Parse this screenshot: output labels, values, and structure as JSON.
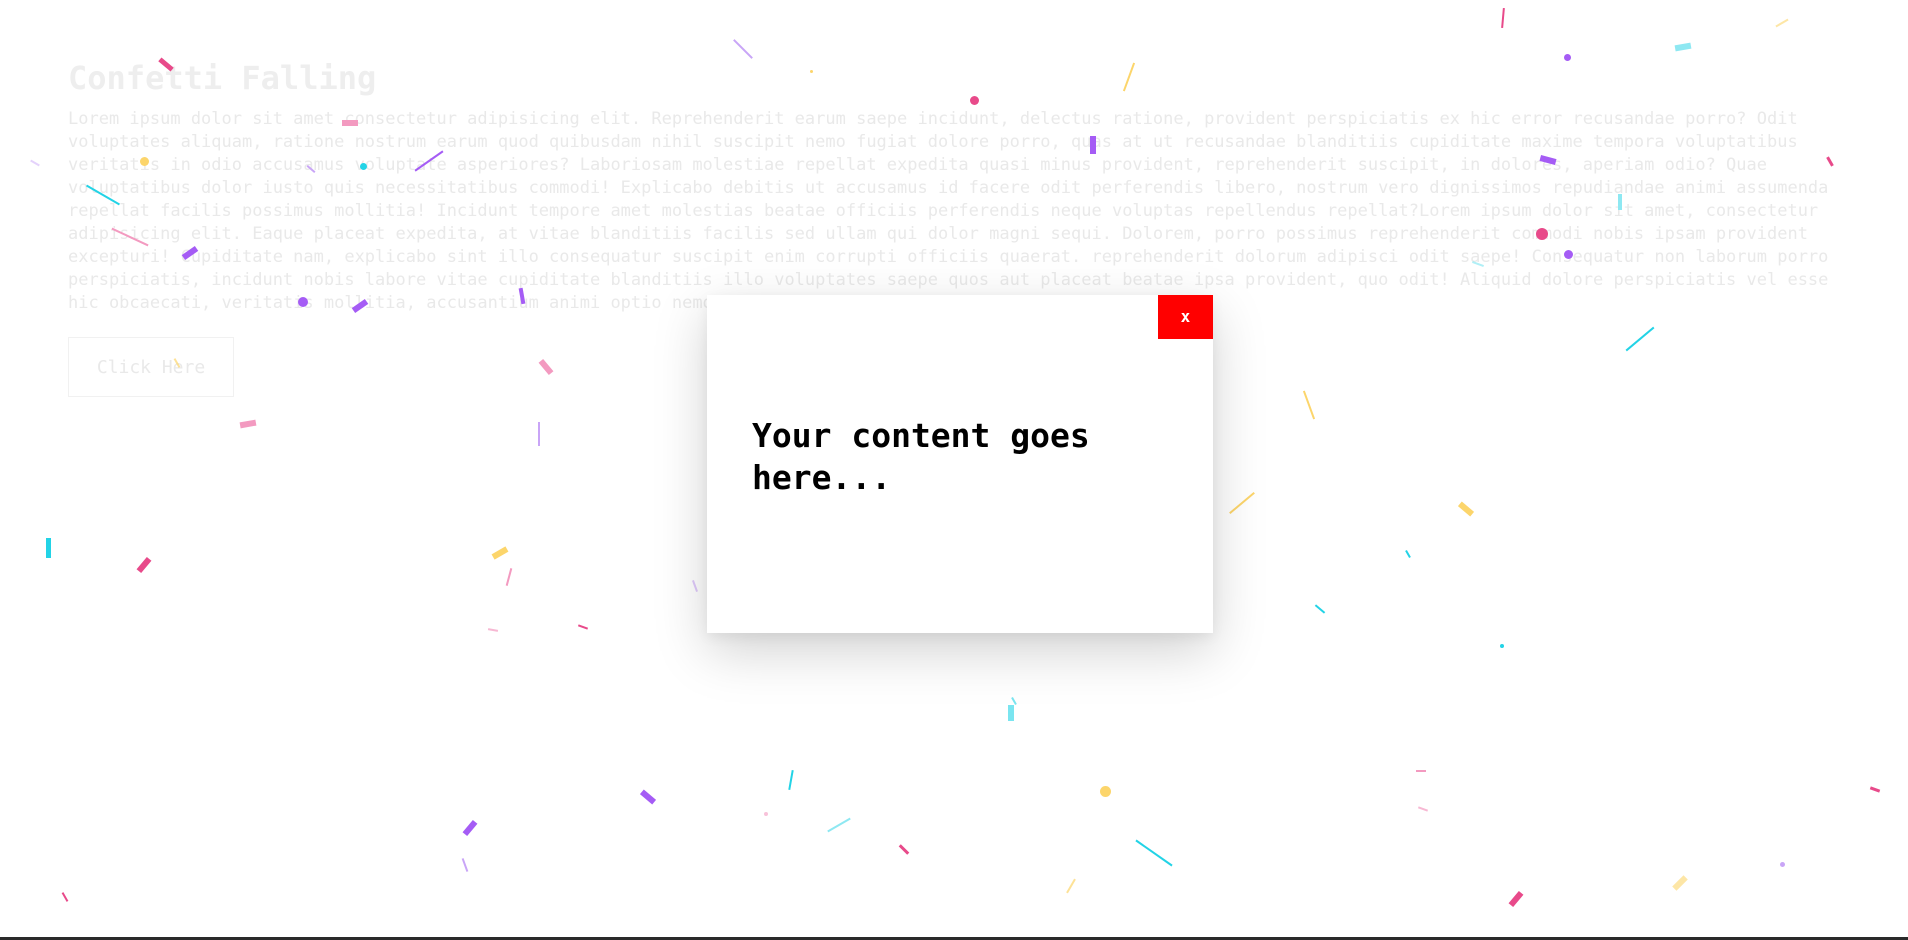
{
  "page": {
    "title": "Confetti Falling",
    "paragraph": "Lorem ipsum dolor sit amet consectetur adipisicing elit. Reprehenderit earum saepe incidunt, delectus ratione, provident perspiciatis ex hic error recusandae porro? Odit voluptates aliquam, ratione nostrum earum quod quibusdam nihil suscipit nemo fugiat dolore porro, quas at ut recusandae blanditiis cupiditate maxime tempora voluptatibus veritatis in odio accusamus voluptate asperiores? Laboriosam molestiae repellat expedita quasi minus provident, reprehenderit suscipit, in dolores, aperiam odio? Quae voluptatibus dolor iusto quis necessitatibus commodi! Explicabo debitis ut accusamus id facere odit perferendis libero, nostrum vero dignissimos repudiandae animi assumenda repellat facilis possimus mollitia! Incidunt tempore amet molestias beatae officiis perferendis neque voluptas repellendus repellat?Lorem ipsum dolor sit amet, consectetur adipisicing elit. Eaque placeat expedita, at vitae blanditiis facilis sed ullam qui dolor magni sequi. Dolorem, porro possimus reprehenderit commodi nobis ipsam provident excepturi! Cupiditate nam, explicabo sint illo consequatur suscipit enim corrupti officiis quaerat. reprehenderit dolorum adipisci odit saepe! Consequatur non laborum porro perspiciatis, incidunt nobis labore vitae cupiditate blanditiis illo voluptates saepe quos aut placeat beatae ipsa provident, quo odit! Aliquid dolore perspiciatis vel esse hic obcaecati, veritatis mollitia, accusantium animi optio nemo enim iure voluptas explicabo cupiditate!",
    "button_label": "Click Here"
  },
  "modal": {
    "close_label": "x",
    "content_text": "Your content goes here..."
  },
  "colors": {
    "close_button_bg": "#ff0000",
    "confetti": [
      "#e84a8a",
      "#a55cf5",
      "#22d3e6",
      "#fcd56b",
      "#f39ac0",
      "#8ee8f2",
      "#c9a5f7"
    ]
  }
}
